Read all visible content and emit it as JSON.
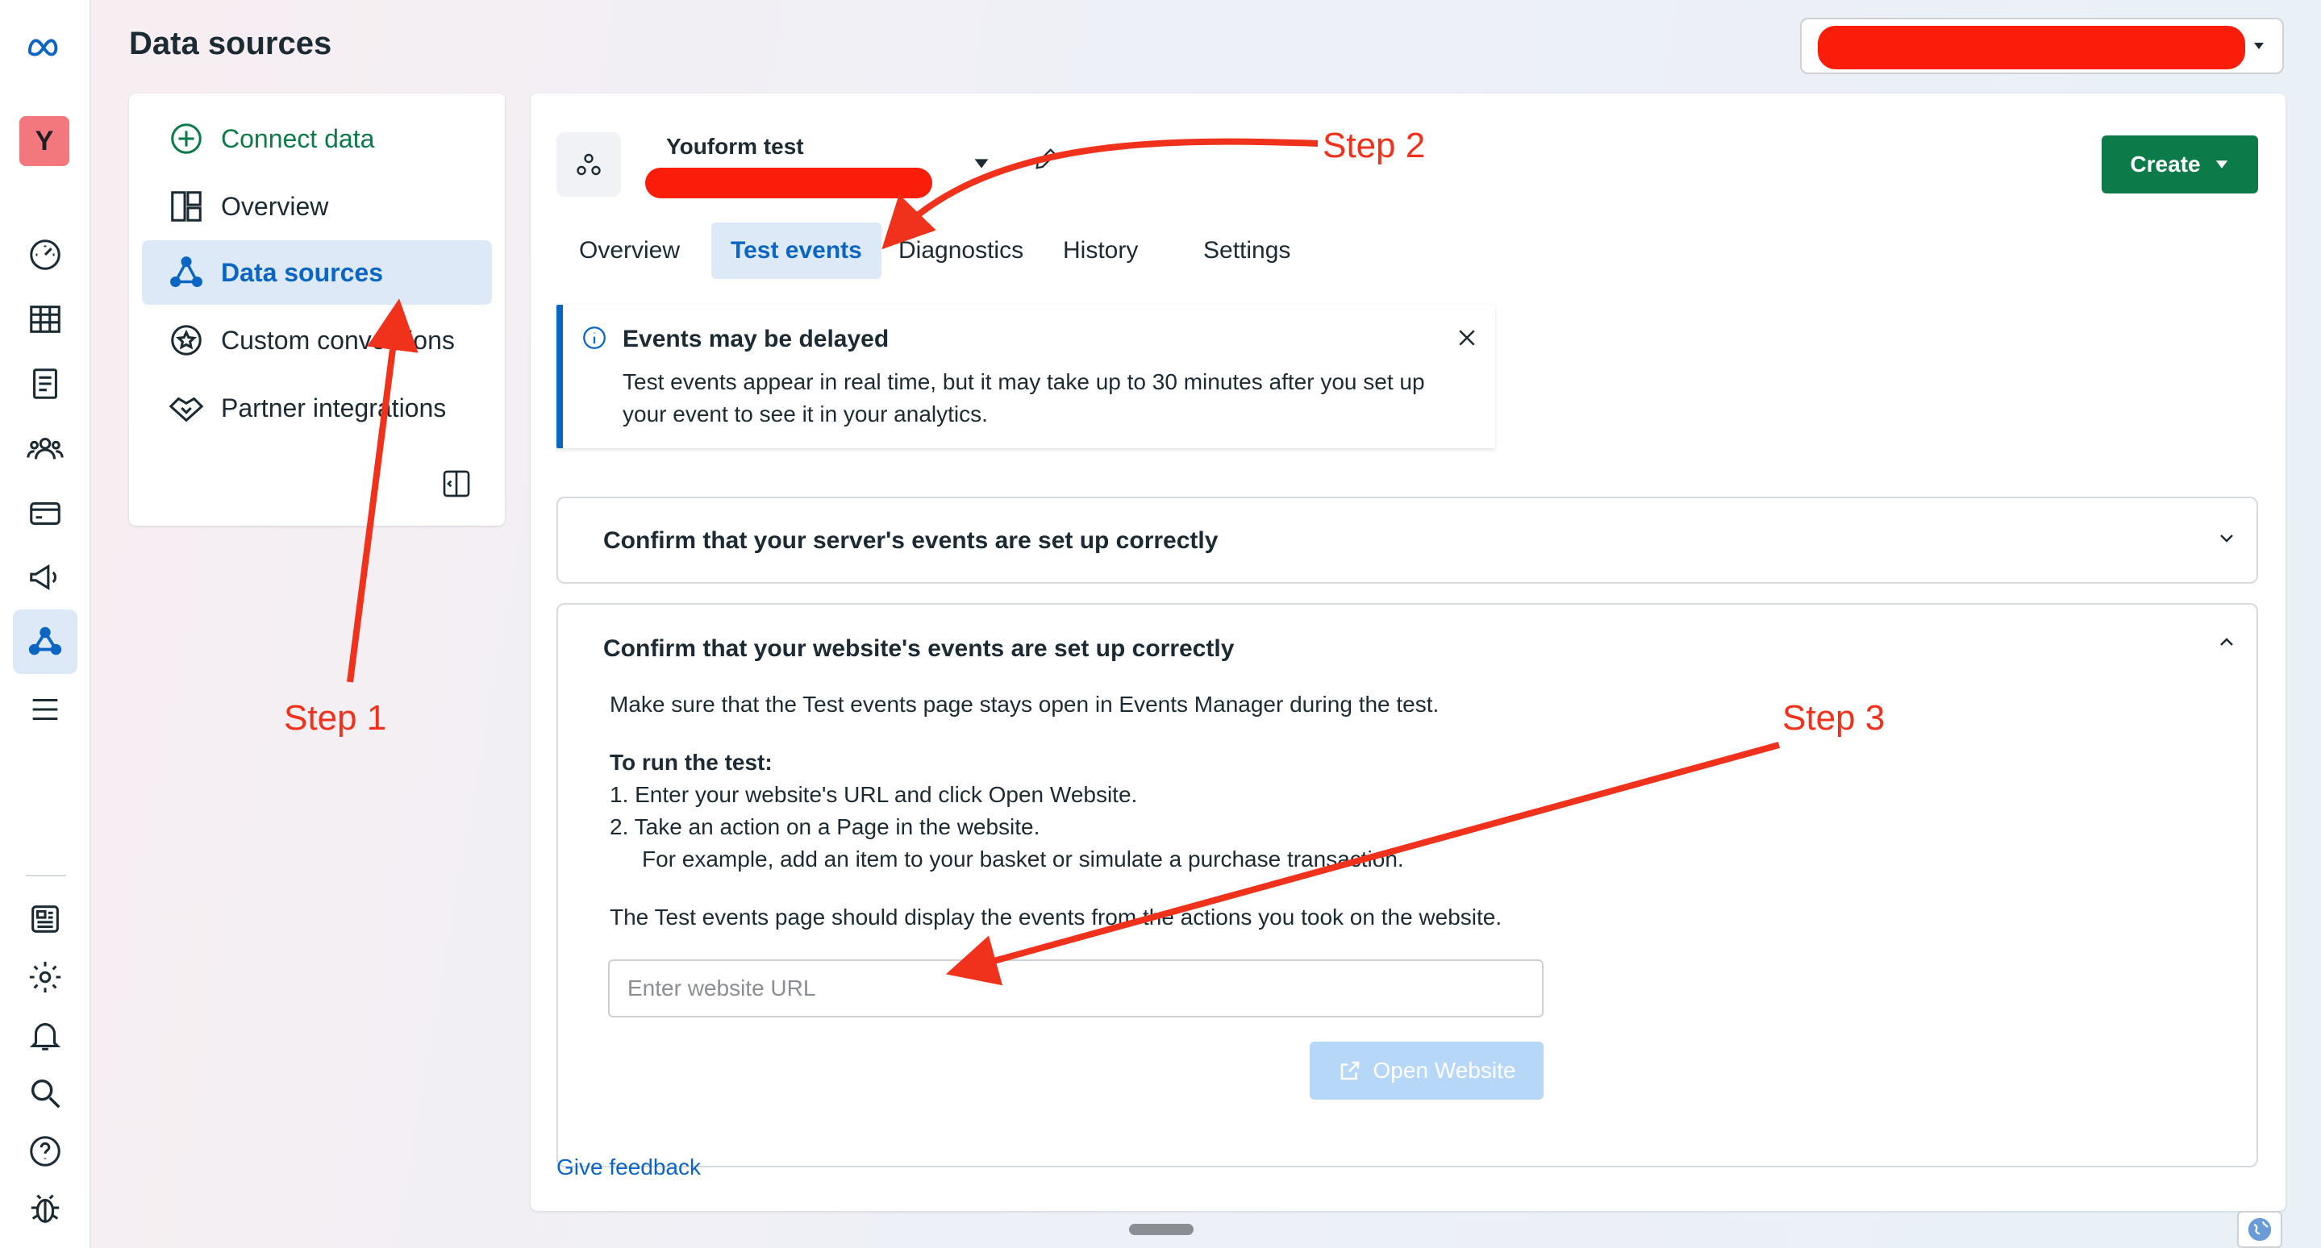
{
  "header": {
    "title": "Data sources"
  },
  "nav": {
    "items": [
      {
        "label": "Connect data"
      },
      {
        "label": "Overview"
      },
      {
        "label": "Data sources"
      },
      {
        "label": "Custom conversions"
      },
      {
        "label": "Partner integrations"
      }
    ]
  },
  "dataset": {
    "name": "Youform test"
  },
  "toolbar": {
    "create_label": "Create"
  },
  "tabs": [
    {
      "label": "Overview"
    },
    {
      "label": "Test events",
      "active": true
    },
    {
      "label": "Diagnostics"
    },
    {
      "label": "History"
    },
    {
      "label": "Settings"
    }
  ],
  "notice": {
    "title": "Events may be delayed",
    "line1": "Test events appear in real time, but it may take up to 30 minutes after you set up",
    "line2": "your event to see it in your analytics."
  },
  "server_section": {
    "title": "Confirm that your server's events are set up correctly"
  },
  "website_section": {
    "title": "Confirm that your website's events are set up correctly",
    "intro": "Make sure that the Test events page stays open in Events Manager during the test.",
    "steps_heading": "To run the test:",
    "step1": "1.  Enter your website's URL and click Open Website.",
    "step2": "2.  Take an action on a Page in the website.",
    "step2_detail": "For example, add an item to your basket or simulate a purchase transaction.",
    "outcome": "The Test events page should display the events from the actions you took on the website.",
    "url_placeholder": "Enter website URL",
    "open_label": "Open Website"
  },
  "feedback": {
    "label": "Give feedback"
  },
  "annotations": {
    "step1": "Step 1",
    "step2": "Step 2",
    "step3": "Step 3"
  },
  "rail": {
    "avatar_letter": "Y"
  },
  "colors": {
    "brand_blue": "#0a66c2",
    "create_green": "#0d7a4a",
    "annotation_red": "#f0311c",
    "redaction": "#fa1d0a"
  }
}
